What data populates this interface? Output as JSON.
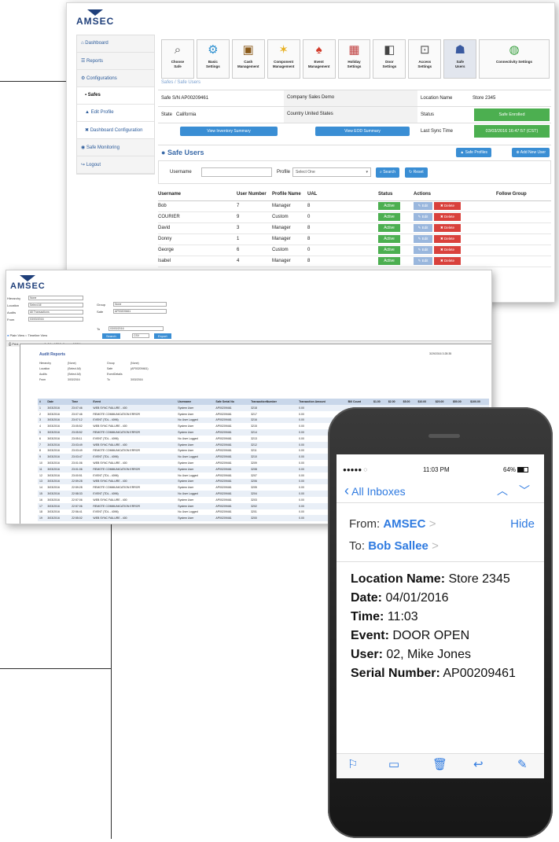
{
  "colors": {
    "brand": "#1f3f7a",
    "accent": "#3a8ed4",
    "active": "#4caf50",
    "danger": "#d9413c",
    "ios_blue": "#2e7ae0"
  },
  "brand": {
    "logo": "AMSEC"
  },
  "sidebar": {
    "items": [
      {
        "label": "Dashboard",
        "icon": "home-icon"
      },
      {
        "label": "Reports",
        "icon": "list-icon"
      },
      {
        "label": "Configurations",
        "icon": "gear-icon"
      },
      {
        "label": "Safes",
        "icon": "square-icon"
      },
      {
        "label": "Edit Profile",
        "icon": "user-icon"
      },
      {
        "label": "Dashboard Configuration",
        "icon": "wrench-icon"
      },
      {
        "label": "Safe Monitoring",
        "icon": "eye-icon"
      },
      {
        "label": "Logout",
        "icon": "logout-icon"
      }
    ]
  },
  "toolbar": [
    {
      "label": "Choose\nSafe",
      "icon": "magnifier-icon"
    },
    {
      "label": "Basic\nSettings",
      "icon": "gear-icon"
    },
    {
      "label": "Cash\nManagement",
      "icon": "cash-bag-icon"
    },
    {
      "label": "Component\nManagement",
      "icon": "star-icon"
    },
    {
      "label": "Event\nManagement",
      "icon": "bell-icon"
    },
    {
      "label": "Holiday\nSettings",
      "icon": "calendar-icon"
    },
    {
      "label": "Door\nSettings",
      "icon": "door-icon"
    },
    {
      "label": "Access\nSettings",
      "icon": "lock-icon"
    },
    {
      "label": "Safe\nUsers",
      "icon": "users-icon"
    },
    {
      "label": "Connectivity Settings",
      "icon": "globe-icon"
    }
  ],
  "breadcrumb": "Safes / Safe Users",
  "safe_info": {
    "sn_label": "Safe S/N",
    "sn": "AP00209461",
    "company_label": "Company",
    "company": "Sales Demo",
    "location_label": "Location Name",
    "location": "Store 2345",
    "state_label": "State",
    "state": "California",
    "country_label": "Country",
    "country": "United States",
    "status_label": "Status",
    "status": "Safe Enrolled",
    "sync_label": "Last Sync Time",
    "sync": "03/03/2016 16:47:57 (CST)",
    "inventory_button": "View Inventory Summary",
    "eod_button": "View EOD Summary"
  },
  "users_section": {
    "title": "Safe Users",
    "profiles_button": "Safe Profiles",
    "add_button": "Add New User",
    "username_label": "Username",
    "profile_label": "Profile",
    "profile_select": "Select One",
    "search_button": "Search",
    "reset_button": "Reset",
    "columns": [
      "Username",
      "User Number",
      "Profile Name",
      "UAL",
      "Status",
      "Actions",
      "Follow Group"
    ],
    "status_text": "Active",
    "edit_text": "Edit",
    "delete_text": "Delete",
    "rows": [
      {
        "username": "Bob",
        "number": "7",
        "profile": "Manager",
        "ual": "8"
      },
      {
        "username": "COURIER",
        "number": "9",
        "profile": "Custom",
        "ual": "0"
      },
      {
        "username": "David",
        "number": "3",
        "profile": "Manager",
        "ual": "8"
      },
      {
        "username": "Donny",
        "number": "1",
        "profile": "Manager",
        "ual": "8"
      },
      {
        "username": "George",
        "number": "6",
        "profile": "Custom",
        "ual": "0"
      },
      {
        "username": "Isabel",
        "number": "4",
        "profile": "Manager",
        "ual": "8"
      }
    ]
  },
  "audit": {
    "logo": "AMSEC",
    "filters": [
      {
        "label": "Hierarchy",
        "value": "None"
      },
      {
        "label": "Location",
        "value": "Select All"
      },
      {
        "label": "Audits",
        "value": "All Transactions"
      },
      {
        "label": "From",
        "value": "03/03/2016"
      }
    ],
    "group_label": "Group",
    "group_value": "None",
    "safe_label": "Safe",
    "safe_value": "AP00209461",
    "to_label": "To",
    "to_value": "03/03/2016",
    "plain_view": "Plain View",
    "timeline_view": "Timeline View",
    "search_button": "Search",
    "csv": "CSV",
    "export_button": "Export",
    "print": "Print",
    "pager": "1 of 29",
    "zoom": "100%",
    "report_title": "Audit Reports",
    "report_date": "3/29/2016 3:28:35",
    "meta": [
      {
        "k": "Hierarchy",
        "v": "(None)",
        "k2": "Group",
        "v2": "(None)"
      },
      {
        "k": "Location",
        "v": "(Select All)",
        "k2": "Safe",
        "v2": "(AP00209461)"
      },
      {
        "k": "Audits",
        "v": "(Select All)",
        "k2": "EventDetails",
        "v2": ""
      },
      {
        "k": "From",
        "v": "3/03/2016",
        "k2": "To",
        "v2": "3/03/2016"
      }
    ],
    "columns": [
      "#",
      "Date",
      "Time",
      "Event",
      "Username",
      "Safe Serial No",
      "TransactionNumber",
      "Transaction Amount",
      "Bill Count",
      "$1.00",
      "$2.00",
      "$5.00",
      "$10.00",
      "$20.00",
      "$50.00",
      "$100.00"
    ],
    "rows": [
      [
        "1",
        "3/03/2016",
        "23:07:46",
        "WEB SYNC FAILURE - 400",
        "System User",
        "AP00209461",
        "3218",
        "0.00"
      ],
      [
        "2",
        "3/03/2016",
        "23:07:46",
        "REMOTE COMMUNICATION ERROR",
        "System User",
        "AP00209461",
        "3217",
        "0.00"
      ],
      [
        "3",
        "3/03/2016",
        "23:07:12",
        "EVENT (TDL - 4096)",
        "No User Logged",
        "AP00209461",
        "3216",
        "0.00"
      ],
      [
        "4",
        "3/03/2016",
        "23:05:52",
        "WEB SYNC FAILURE - 400",
        "System User",
        "AP00209461",
        "3215",
        "0.00"
      ],
      [
        "5",
        "3/03/2016",
        "23:05:52",
        "REMOTE COMMUNICATION ERROR",
        "System User",
        "AP00209461",
        "3214",
        "0.00"
      ],
      [
        "6",
        "3/03/2016",
        "23:05:11",
        "EVENT (TDL - 4096)",
        "No User Logged",
        "AP00209461",
        "3213",
        "0.00"
      ],
      [
        "7",
        "3/03/2016",
        "23:03:49",
        "WEB SYNC FAILURE - 400",
        "System User",
        "AP00209461",
        "3212",
        "0.00"
      ],
      [
        "8",
        "3/03/2016",
        "23:03:49",
        "REMOTE COMMUNICATION ERROR",
        "System User",
        "AP00209461",
        "3211",
        "0.00"
      ],
      [
        "9",
        "3/03/2016",
        "23:03:47",
        "EVENT (TDL - 4096)",
        "No User Logged",
        "AP00209461",
        "3210",
        "0.00"
      ],
      [
        "10",
        "3/03/2016",
        "23:01:06",
        "WEB SYNC FAILURE - 400",
        "System User",
        "AP00209461",
        "3209",
        "0.00"
      ],
      [
        "11",
        "3/03/2016",
        "23:01:06",
        "REMOTE COMMUNICATION ERROR",
        "System User",
        "AP00209461",
        "3208",
        "0.00"
      ],
      [
        "12",
        "3/03/2016",
        "23:00:51",
        "EVENT (TDL - 4096)",
        "No User Logged",
        "AP00209461",
        "3207",
        "0.00"
      ],
      [
        "13",
        "3/03/2016",
        "22:59:28",
        "WEB SYNC FAILURE - 400",
        "System User",
        "AP00209461",
        "3206",
        "0.00"
      ],
      [
        "14",
        "3/03/2016",
        "22:59:28",
        "REMOTE COMMUNICATION ERROR",
        "System User",
        "AP00209461",
        "3205",
        "0.00"
      ],
      [
        "15",
        "3/03/2016",
        "22:58:33",
        "EVENT (TDL - 4096)",
        "No User Logged",
        "AP00209461",
        "3204",
        "0.00"
      ],
      [
        "16",
        "3/03/2016",
        "22:57:06",
        "WEB SYNC FAILURE - 400",
        "System User",
        "AP00209461",
        "3203",
        "0.00"
      ],
      [
        "17",
        "3/03/2016",
        "22:57:06",
        "REMOTE COMMUNICATION ERROR",
        "System User",
        "AP00209461",
        "3202",
        "0.00"
      ],
      [
        "18",
        "3/03/2016",
        "22:56:41",
        "EVENT (TDL - 4096)",
        "No User Logged",
        "AP00209461",
        "3201",
        "0.00"
      ],
      [
        "19",
        "3/03/2016",
        "22:55:02",
        "WEB SYNC FAILURE - 400",
        "System User",
        "AP00209461",
        "3200",
        "0.00"
      ]
    ]
  },
  "phone": {
    "carrier": "●●●●● ◌",
    "time": "11:03 PM",
    "battery": "64%",
    "back": "All Inboxes",
    "from_label": "From:",
    "from": "AMSEC",
    "to_label": "To:",
    "to": "Bob Sallee",
    "hide": "Hide",
    "lines": [
      {
        "label": "Location Name:",
        "value": "Store 2345"
      },
      {
        "label": "Date:",
        "value": "04/01/2016"
      },
      {
        "label": "Time:",
        "value": "11:03"
      },
      {
        "label": "Event:",
        "value": "DOOR OPEN"
      },
      {
        "label": "User:",
        "value": "02, Mike Jones"
      },
      {
        "label": "Serial Number:",
        "value": "AP00209461"
      }
    ],
    "toolbar_icons": [
      "flag-icon",
      "folder-icon",
      "trash-icon",
      "reply-icon",
      "compose-icon"
    ]
  }
}
